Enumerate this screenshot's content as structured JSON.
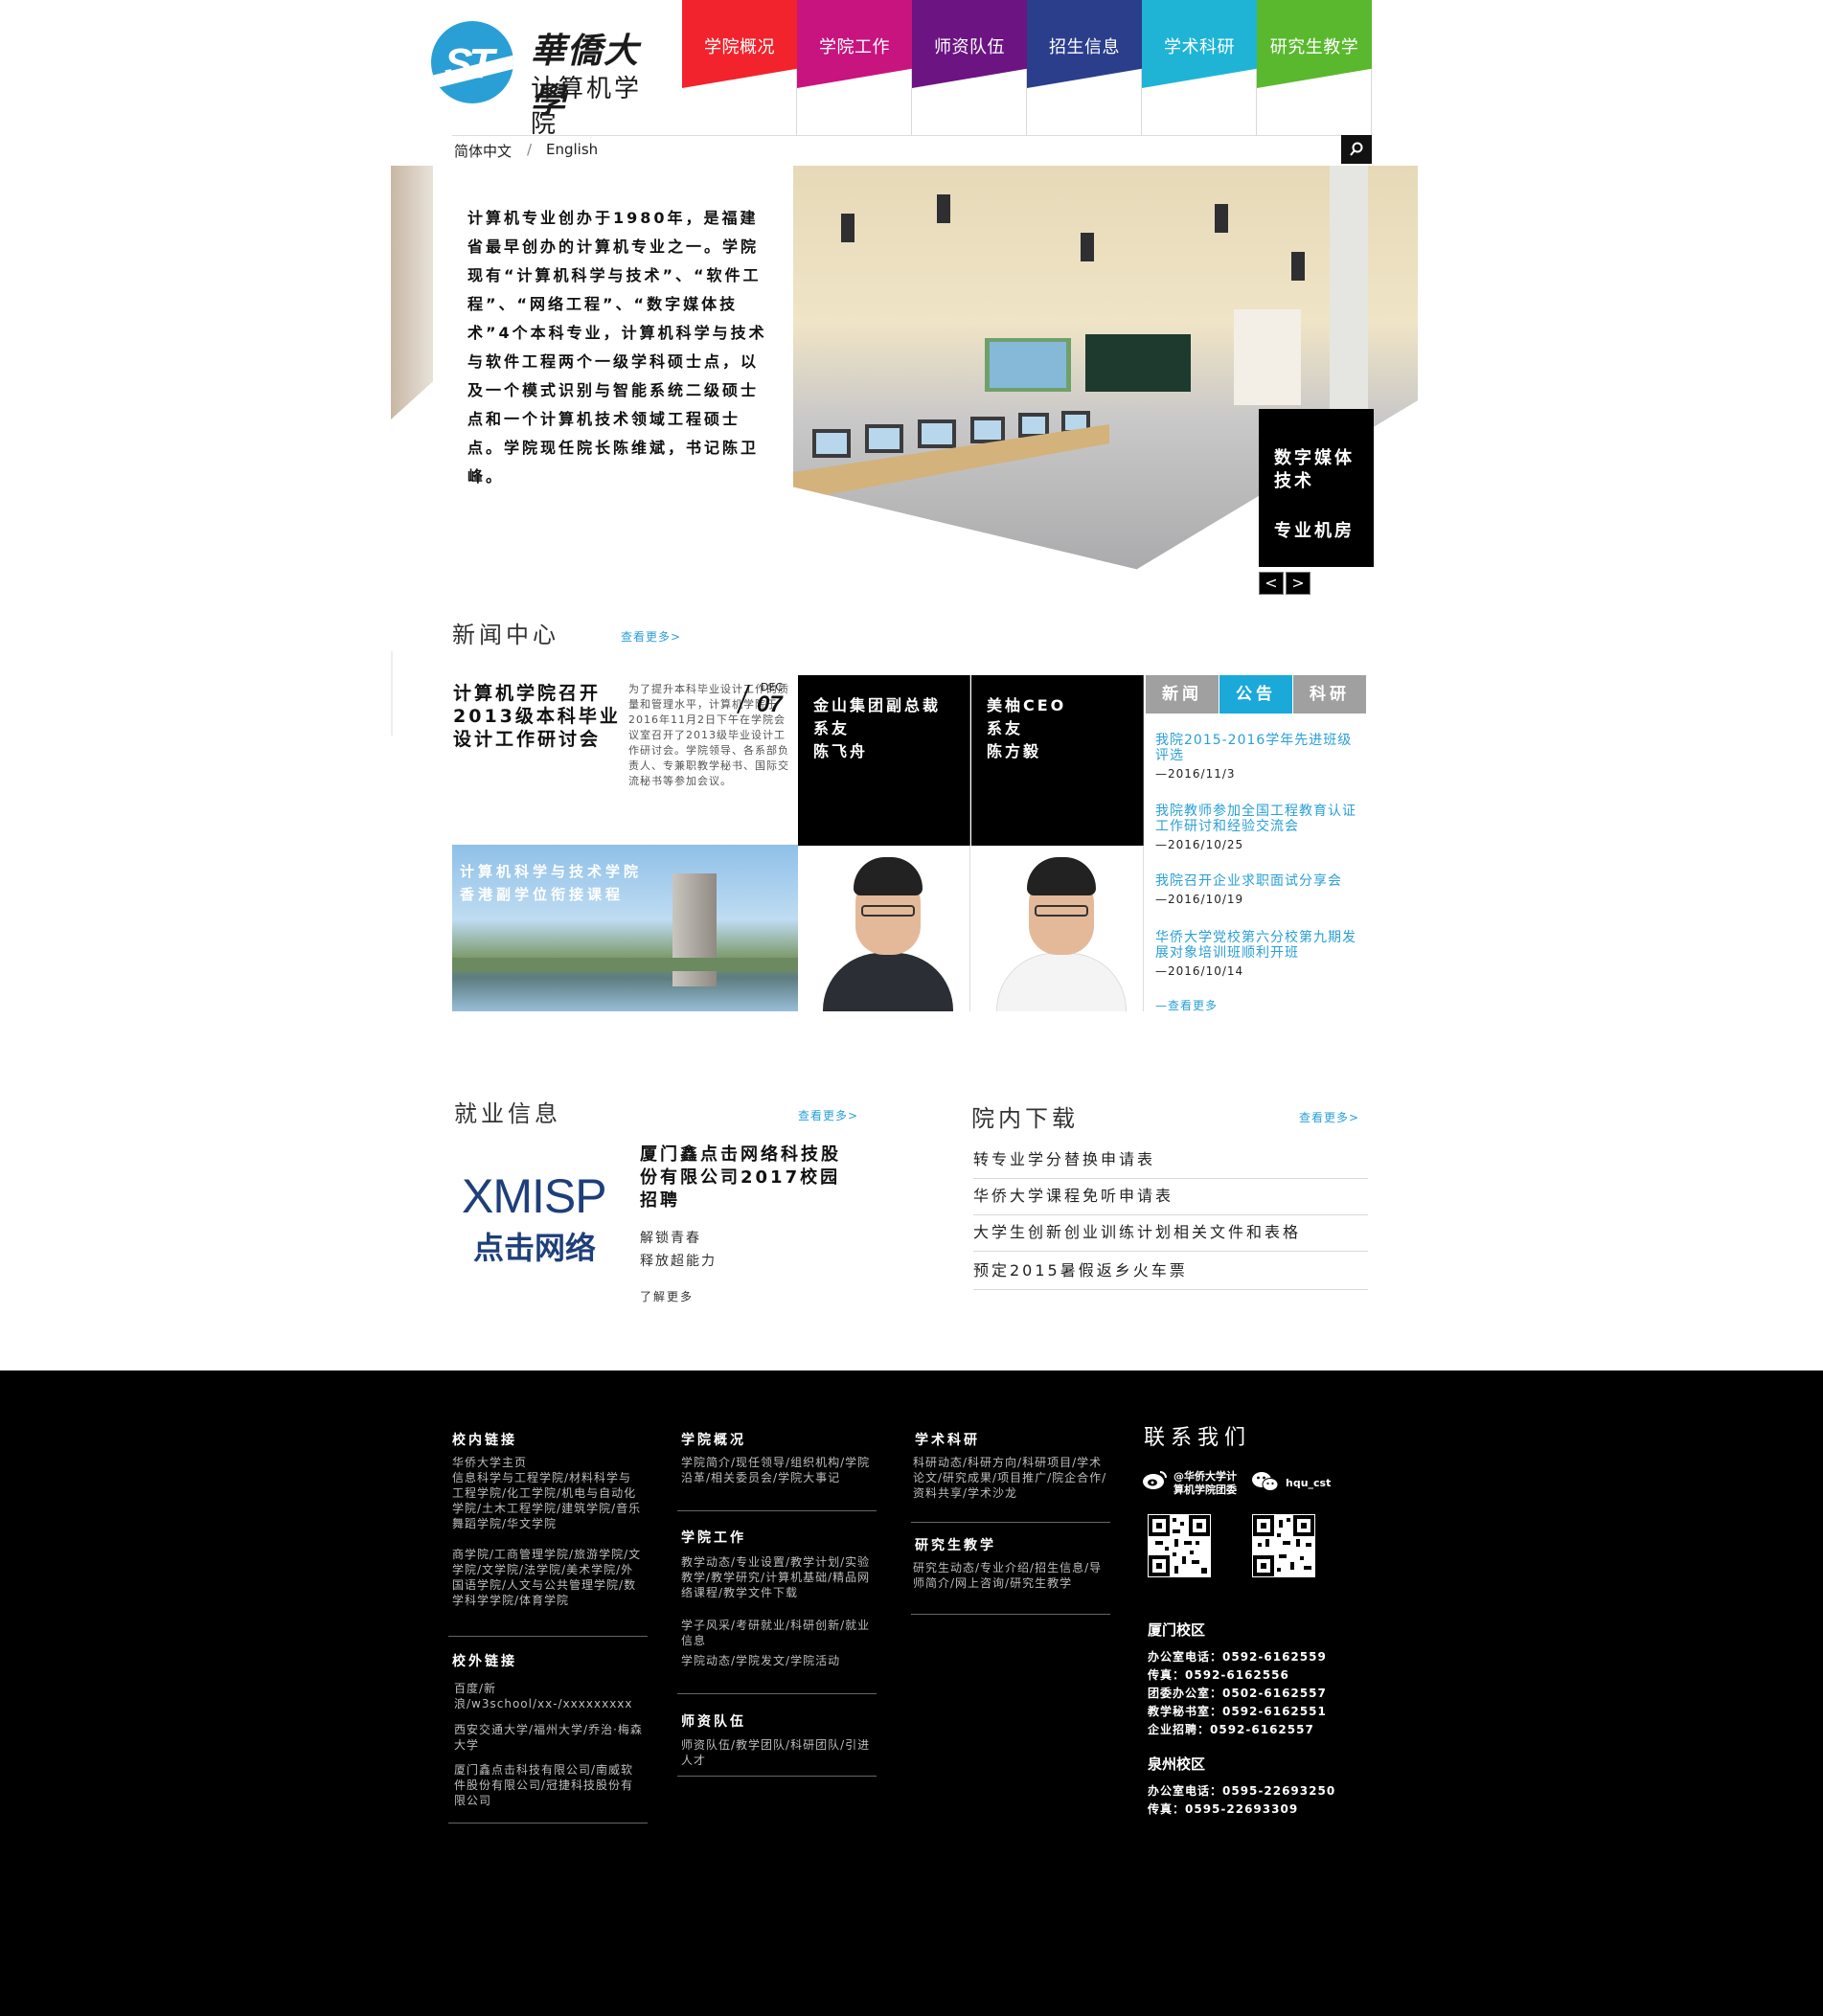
{
  "header": {
    "logo_cn": "華僑大學",
    "logo_sub": "计算机学院",
    "nav": [
      {
        "label": "学院概况",
        "color": "#f2232c"
      },
      {
        "label": "学院工作",
        "color": "#c8147f"
      },
      {
        "label": "师资队伍",
        "color": "#6b1482"
      },
      {
        "label": "招生信息",
        "color": "#2a3e8c"
      },
      {
        "label": "学术科研",
        "color": "#1fb4d5"
      },
      {
        "label": "研究生教学",
        "color": "#5ab82e"
      }
    ],
    "lang_cn": "简体中文",
    "lang_sep": "/",
    "lang_en": "English"
  },
  "hero": {
    "intro": "计算机专业创办于1980年，是福建省最早创办的计算机专业之一。学院现有“计算机科学与技术”、“软件工程”、“网络工程”、“数字媒体技术”4个本科专业，计算机科学与技术与软件工程两个一级学科硕士点，以及一个模式识别与智能系统二级硕士点和一个计算机技术领域工程硕士点。学院现任院长陈维斌，书记陈卫峰。",
    "box_title": "数字媒体技术",
    "box_sub": "专业机房",
    "prev": "<",
    "next": ">"
  },
  "news": {
    "title": "新闻中心",
    "more": "查看更多>",
    "feature_title": "计算机学院召开2013级本科毕业设计工作研讨会",
    "feature_body": "为了提升本科毕业设计工作的质量和管理水平，计算机学院于2016年11月2日下午在学院会议室召开了2013级毕业设计工作研讨会。学院领导、各系部负责人、专兼职教学秘书、国际交流秘书等参加会议。",
    "date_month": "DEC",
    "date_day": "07",
    "campus_caption_1": "计算机科学与技术学院",
    "campus_caption_2": "香港副学位衔接课程",
    "alumni": [
      {
        "l1": "金山集团副总裁",
        "l2": "系友",
        "l3": "陈飞舟"
      },
      {
        "l1": "美柚CEO",
        "l2": "系友",
        "l3": "陈方毅"
      }
    ],
    "tabs": [
      {
        "label": "新闻",
        "color": "#a0a0a0"
      },
      {
        "label": "公告",
        "color": "#1aa9d8"
      },
      {
        "label": "科研",
        "color": "#a0a0a0"
      }
    ],
    "announcements": [
      {
        "title": "我院2015-2016学年先进班级评选",
        "date": "—2016/11/3"
      },
      {
        "title": "我院教师参加全国工程教育认证工作研讨和经验交流会",
        "date": "—2016/10/25"
      },
      {
        "title": "我院召开企业求职面试分享会",
        "date": "—2016/10/19"
      },
      {
        "title": "华侨大学党校第六分校第九期发展对象培训班顺利开班",
        "date": "—2016/10/14"
      }
    ],
    "ann_more": "—查看更多"
  },
  "jobs": {
    "title": "就业信息",
    "more": "查看更多>",
    "logo_en": "XMISP",
    "logo_cn": "点击网络",
    "headline": "厦门鑫点击网络科技股份有限公司2017校园招聘",
    "line1": "解锁青春",
    "line2": "释放超能力",
    "read_more": "了解更多"
  },
  "downloads": {
    "title": "院内下载",
    "more": "查看更多>",
    "items": [
      "转专业学分替换申请表",
      "华侨大学课程免听申请表",
      "大学生创新创业训练计划相关文件和表格",
      "预定2015暑假返乡火车票"
    ]
  },
  "footer": {
    "col1": {
      "head1": "校内链接",
      "text1": "华侨大学主页",
      "text2": "信息科学与工程学院/材料科学与工程学院/化工学院/机电与自动化学院/土木工程学院/建筑学院/音乐舞蹈学院/华文学院",
      "text3": "商学院/工商管理学院/旅游学院/文学院/文学院/法学院/美术学院/外国语学院/人文与公共管理学院/数学科学学院/体育学院",
      "head2": "校外链接",
      "text4": "百度/新浪/w3school/xx-/xxxxxxxxx",
      "text5": "西安交通大学/福州大学/乔治·梅森大学",
      "text6": "厦门鑫点击科技有限公司/南威软件股份有限公司/冠捷科技股份有限公司"
    },
    "col2": {
      "head1": "学院概况",
      "text1": "学院简介/现任领导/组织机构/学院沿革/相关委员会/学院大事记",
      "head2": "学院工作",
      "text2": "教学动态/专业设置/教学计划/实验教学/教学研究/计算机基础/精品网络课程/教学文件下载",
      "text3": "学子风采/考研就业/科研创新/就业信息",
      "text4": "学院动态/学院发文/学院活动",
      "head3": "师资队伍",
      "text5": "师资队伍/教学团队/科研团队/引进人才"
    },
    "col3": {
      "head1": "学术科研",
      "text1": "科研动态/科研方向/科研项目/学术论文/研究成果/项目推广/院企合作/资料共享/学术沙龙",
      "head2": "研究生教学",
      "text2": "研究生动态/专业介绍/招生信息/导师简介/网上咨询/研究生教学"
    },
    "contact": {
      "title": "联系我们",
      "weibo_1": "@华侨大学计",
      "weibo_2": "算机学院团委",
      "wechat": "hqu_cst",
      "xm_title": "厦门校区",
      "xm_lines": [
        "办公室电话：0592-6162559",
        "传真：0592-6162556",
        "团委办公室：0502-6162557",
        "教学秘书室：0592-6162551",
        "企业招聘：0592-6162557"
      ],
      "qz_title": "泉州校区",
      "qz_lines": [
        "办公室电话：0595-22693250",
        "传真：0595-22693309"
      ]
    }
  }
}
